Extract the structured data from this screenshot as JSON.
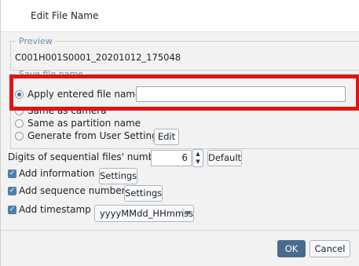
{
  "dialog": {
    "title": "Edit File Name"
  },
  "preview": {
    "legend": "Preview",
    "value": "C001H001S0001_20201012_175048"
  },
  "save_file_name": {
    "legend": "Save file name",
    "options": [
      {
        "label": "Apply entered file name",
        "selected": true
      },
      {
        "label": "Same as camera",
        "selected": false
      },
      {
        "label": "Same as partition name",
        "selected": false
      },
      {
        "label": "Generate from User Settings",
        "selected": false
      }
    ],
    "file_name_value": "",
    "edit_button": "Edit"
  },
  "digits": {
    "label": "Digits of sequential files' number",
    "value": "6",
    "default_button": "Default"
  },
  "add_information": {
    "label": "Add information",
    "checked": true,
    "settings_button": "Settings"
  },
  "add_sequence": {
    "label": "Add sequence number",
    "checked": true,
    "settings_button": "Settings"
  },
  "add_timestamp": {
    "label": "Add timestamp",
    "checked": true,
    "format_value": "yyyyMMdd_HHmmss"
  },
  "footer": {
    "ok_label": "OK",
    "cancel_label": "Cancel"
  },
  "colors": {
    "highlight": "#e11414",
    "accent": "#4e7fad",
    "ok_button": "#4b6b8c"
  }
}
